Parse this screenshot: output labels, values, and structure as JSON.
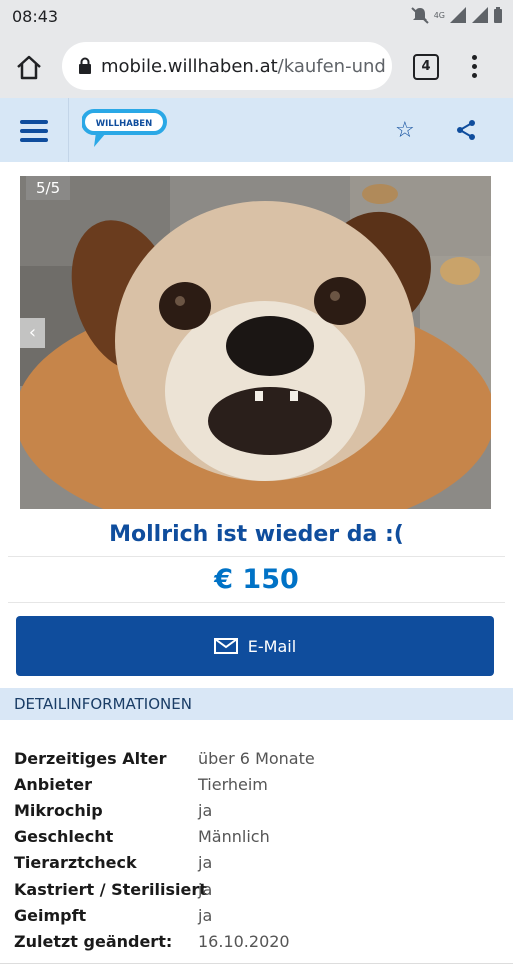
{
  "status_bar": {
    "time": "08:43",
    "network": "4G"
  },
  "browser": {
    "url_domain": "mobile.willhaben.at",
    "url_path": "/kaufen-und",
    "tab_count": "4"
  },
  "header": {
    "logo_text": "WILLHABEN"
  },
  "gallery": {
    "counter": "5/5"
  },
  "listing": {
    "title": "Mollrich ist wieder da :(",
    "price": "€ 150",
    "email_label": "E-Mail"
  },
  "details": {
    "heading": "DETAILINFORMATIONEN",
    "rows": [
      {
        "label": "Derzeitiges Alter",
        "value": "über 6 Monate"
      },
      {
        "label": "Anbieter",
        "value": "Tierheim"
      },
      {
        "label": "Mikrochip",
        "value": "ja"
      },
      {
        "label": "Geschlecht",
        "value": "Männlich"
      },
      {
        "label": "Tierarztcheck",
        "value": "ja"
      },
      {
        "label": "Kastriert / Sterilisiert",
        "value": "ja"
      },
      {
        "label": "Geimpft",
        "value": "ja"
      },
      {
        "label": "Zuletzt geändert:",
        "value": "16.10.2020"
      }
    ]
  },
  "colors": {
    "brand_blue": "#0f4d9d",
    "price_blue": "#0072c6",
    "header_bg": "#d7e7f6",
    "chrome_bg": "#e7e8ea"
  }
}
